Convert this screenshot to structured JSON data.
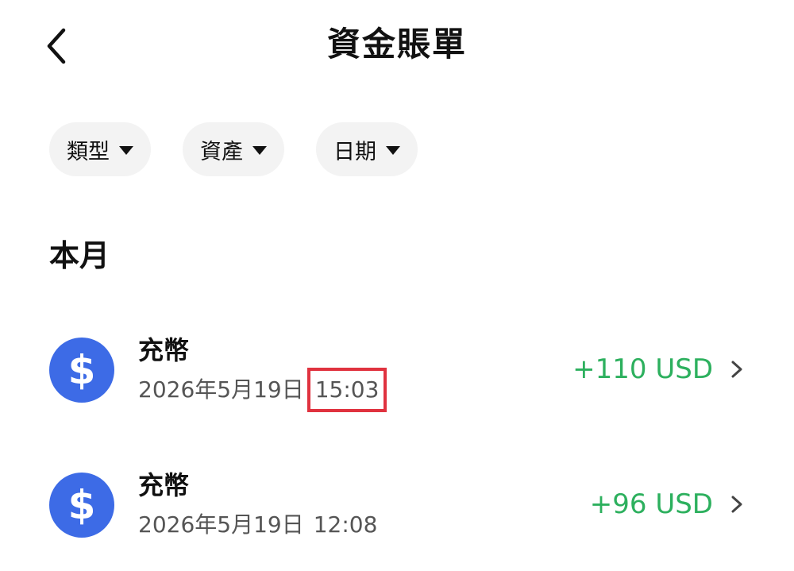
{
  "header": {
    "title": "資金賬單",
    "back_icon": "chevron-left-icon"
  },
  "filters": [
    {
      "label": "類型"
    },
    {
      "label": "資產"
    },
    {
      "label": "日期"
    }
  ],
  "section": {
    "title": "本月"
  },
  "transactions": [
    {
      "name": "充幣",
      "date": "2026年5月19日",
      "time": "15:03",
      "amount": "+110 USD",
      "icon": "dollar-coin-icon",
      "highlighted_time": true
    },
    {
      "name": "充幣",
      "date": "2026年5月19日",
      "time": "12:08",
      "amount": "+96 USD",
      "icon": "dollar-coin-icon",
      "highlighted_time": false
    }
  ],
  "colors": {
    "coin_bg": "#3d6be6",
    "amount_green": "#2db05e",
    "highlight_red": "#e0323f",
    "chip_bg": "#f3f3f3"
  }
}
